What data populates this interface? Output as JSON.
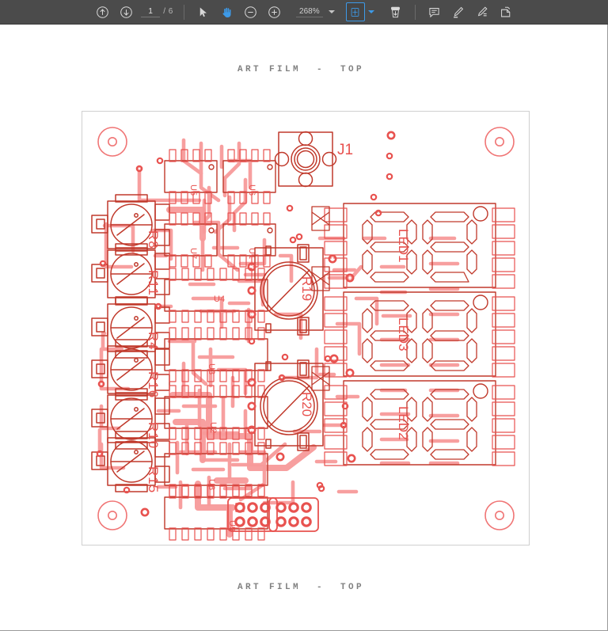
{
  "app": {
    "viewer": "pdf-viewer",
    "background_color": "#ffffff",
    "toolbar_color": "#4b4b4b",
    "accent_color": "#3d9ae8"
  },
  "toolbar": {
    "prev_page_label": "",
    "next_page_label": "",
    "page_current": "1",
    "page_separator": "/ 6",
    "page_total": "6",
    "select_tool_label": "",
    "pan_tool_label": "",
    "zoom_out_label": "",
    "zoom_in_label": "",
    "zoom_level": "268%",
    "fit_label": "",
    "download_label": "",
    "comment_label": "",
    "highlight_label": "",
    "draw_label": "",
    "stamp_label": "",
    "icons": [
      "arrow-up-circle-icon",
      "arrow-down-circle-icon",
      "cursor-arrow-icon",
      "hand-pan-icon",
      "minus-circle-icon",
      "plus-circle-icon",
      "chevron-down-icon",
      "fit-page-icon",
      "download-icon",
      "comment-icon",
      "highlighter-icon",
      "pen-icon",
      "stamp-icon"
    ]
  },
  "document": {
    "title_top": "ART FILM  -  TOP",
    "title_bottom": "ART FILM  -  TOP",
    "artwork_color": "#f46e6e",
    "artwork_fill": "#f9a0a0",
    "page_border_color": "#cfcfcf"
  },
  "pcb": {
    "layer_name": "ART FILM - TOP",
    "silkscreen_color": "#e8524f",
    "copper_color": "#f58b8b",
    "refdes": {
      "connector": "J1",
      "pots": [
        "R8",
        "R11",
        "R4",
        "R16",
        "R10",
        "R15"
      ],
      "round_parts": [
        "R19",
        "R20"
      ],
      "displays": [
        "LED1",
        "LED3",
        "LED2"
      ],
      "ics": [
        "U5",
        "U6",
        "U7",
        "U1",
        "U4",
        "U3",
        "U2",
        "U8",
        "U9"
      ]
    },
    "mounting_holes": 4,
    "headers": 2,
    "header_pins": "2x3"
  }
}
